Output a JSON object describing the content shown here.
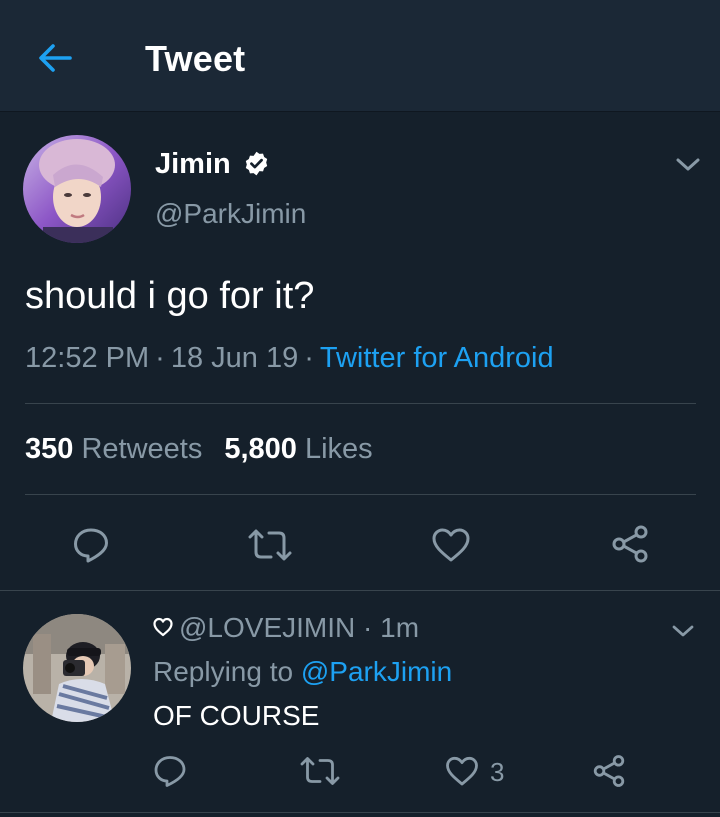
{
  "header": {
    "title": "Tweet",
    "back_icon": "arrow-left-icon",
    "accent_color": "#1da1f2"
  },
  "tweet": {
    "display_name": "Jimin",
    "handle": "@ParkJimin",
    "verified": true,
    "text": "should i go for it?",
    "time": "12:52 PM",
    "separator": "·",
    "date": "18 Jun 19",
    "source": "Twitter for Android",
    "retweets_count": "350",
    "retweets_label": "Retweets",
    "likes_count": "5,800",
    "likes_label": "Likes",
    "actions": [
      "reply-icon",
      "retweet-icon",
      "like-icon",
      "share-icon"
    ]
  },
  "reply": {
    "prefix_icon": "heart-outline-icon",
    "handle": "@LOVEJIMIN",
    "separator": "·",
    "time": "1m",
    "replying_to_label": "Replying to",
    "replying_to_handle": "@ParkJimin",
    "text": "OF COURSE",
    "like_count": "3",
    "actions": [
      "reply-icon",
      "retweet-icon",
      "like-icon",
      "share-icon"
    ]
  },
  "colors": {
    "background": "#15202b",
    "header_background": "#1b2836",
    "secondary_text": "#8899a6",
    "link": "#1da1f2",
    "divider": "#38444d"
  }
}
